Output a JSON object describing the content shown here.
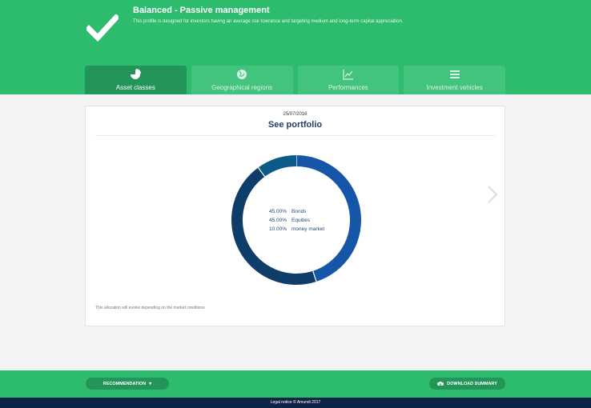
{
  "profile": {
    "title": "Balanced - Passive management",
    "description": "This profile is designed for investors having an average risk tolerance and targeting medium and long-term capital appreciation."
  },
  "tabs": [
    {
      "label": "Asset classes",
      "icon": "pie-chart-icon"
    },
    {
      "label": "Geographical regions",
      "icon": "globe-icon"
    },
    {
      "label": "Performances",
      "icon": "line-chart-icon"
    },
    {
      "label": "Investment vehicles",
      "icon": "list-icon"
    }
  ],
  "portfolio": {
    "date": "25/07/2016",
    "title": "See portfolio",
    "allocation": [
      {
        "pct": "45.00%",
        "label": "Bonds",
        "value": 45,
        "color": "#1656a8"
      },
      {
        "pct": "45.00%",
        "label": "Equities",
        "value": 45,
        "color": "#0f3d6a"
      },
      {
        "pct": "10.00%",
        "label": "money market",
        "value": 10,
        "color": "#0b5a8a"
      }
    ],
    "note": "This allocation will evolve depending on the market conditions"
  },
  "footer": {
    "recommendation": "RECOMMENDATION",
    "download": "DOWNLOAD SUMMARY"
  },
  "bottombar": {
    "legal": "Legal notice © Amundi 2017"
  },
  "colors": {
    "accent": "#2dbb6e",
    "accent_dark": "#23955a",
    "navy": "#0f2347"
  }
}
